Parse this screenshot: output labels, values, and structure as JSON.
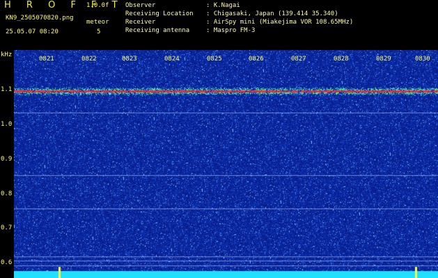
{
  "header": {
    "title": "H R O F F T",
    "version": "1.0.0f",
    "filename": "KN9_2505070820.png",
    "datetime": "25.05.07 08:20",
    "meteor_label": "meteor",
    "meteor_count": "5"
  },
  "info": [
    {
      "label": "Observer",
      "value": ": K.Nagai"
    },
    {
      "label": "Receiving Location",
      "value": ": Chigasaki, Japan (139.414 35.340)"
    },
    {
      "label": "Receiver",
      "value": ": AirSpy mini (Miakejima VOR 108.65MHz)"
    },
    {
      "label": "Receiving antenna",
      "value": ": Maspro FM-3"
    }
  ],
  "axis": {
    "unit": "kHz",
    "freq_ticks": [
      "1.1",
      "1.0",
      "0.9",
      "0.8",
      "0.7",
      "0.6"
    ],
    "time_ticks": [
      "0821",
      "0822",
      "0823",
      "0824",
      "0825",
      "0826",
      "0827",
      "0828",
      "0829",
      "0830"
    ]
  },
  "colors": {
    "background": "#0a1a8a",
    "text": "#ffff66",
    "carrier": "#ff3030"
  }
}
